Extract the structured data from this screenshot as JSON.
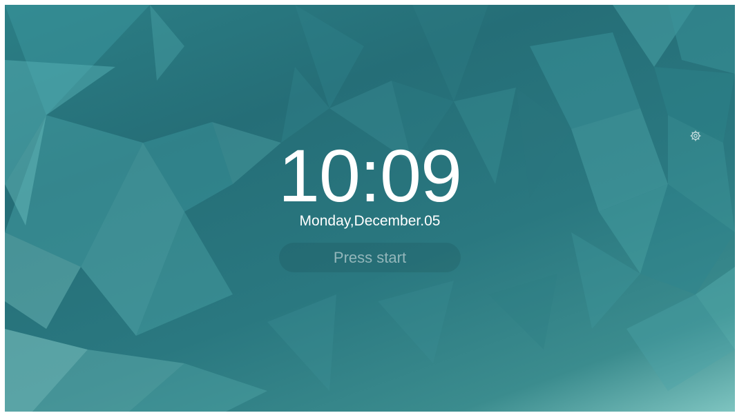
{
  "lockscreen": {
    "time": "10:09",
    "date": "Monday,December.05",
    "press_start_label": "Press start"
  },
  "icons": {
    "settings": "gear-icon"
  },
  "colors": {
    "background_primary": "#256e77",
    "background_light": "#7ec4c0",
    "text": "#ffffff"
  }
}
